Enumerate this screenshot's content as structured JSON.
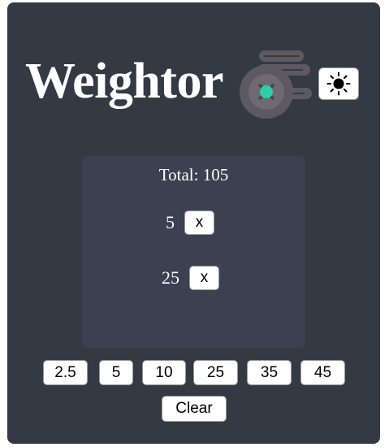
{
  "app": {
    "title": "Weightor"
  },
  "header": {
    "theme_icon": "sun-icon"
  },
  "summary": {
    "total_label": "Total: 105"
  },
  "entries": [
    {
      "value": "5",
      "remove_label": "x"
    },
    {
      "value": "25",
      "remove_label": "x"
    }
  ],
  "weights": [
    "2.5",
    "5",
    "10",
    "25",
    "35",
    "45"
  ],
  "actions": {
    "clear_label": "Clear"
  },
  "colors": {
    "background": "#343a43",
    "panel": "#3b4150",
    "accent": "#2ecfa8"
  }
}
